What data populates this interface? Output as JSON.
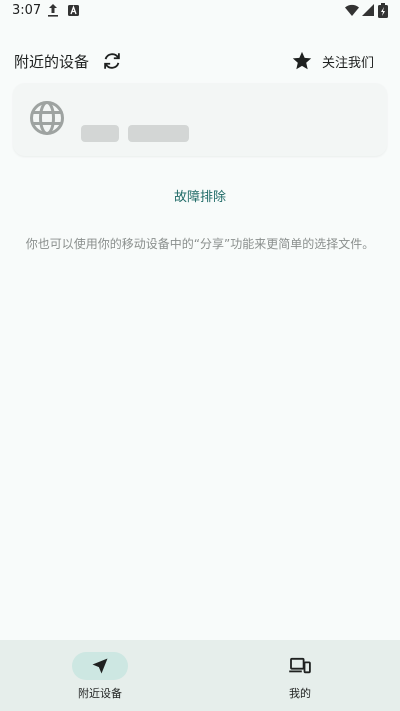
{
  "status_bar": {
    "time": "3:07",
    "icons": [
      "upload-icon",
      "app-a-icon",
      "wifi-icon",
      "signal-icon",
      "battery-icon"
    ]
  },
  "header": {
    "title": "附近的设备",
    "refresh_icon": "refresh-icon",
    "follow_label": "关注我们",
    "follow_icon": "star-icon"
  },
  "device_card": {
    "icon": "globe-icon"
  },
  "troubleshoot": {
    "label": "故障排除"
  },
  "hint": {
    "text": "你也可以使用你的移动设备中的“分享”功能来更简单的选择文件。"
  },
  "bottom_nav": {
    "items": [
      {
        "label": "附近设备",
        "icon": "send-icon",
        "active": true
      },
      {
        "label": "我的",
        "icon": "devices-icon",
        "active": false
      }
    ]
  },
  "colors": {
    "background": "#f8fbfa",
    "accent": "#1e6a66",
    "nav_background": "#e6eeeb",
    "nav_active_pill": "#cde7e2"
  }
}
